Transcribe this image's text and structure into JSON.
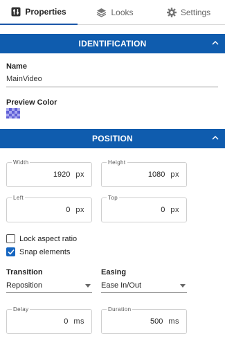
{
  "tabs": [
    {
      "label": "Properties",
      "icon": "properties-icon",
      "active": true
    },
    {
      "label": "Looks",
      "icon": "layers-icon"
    },
    {
      "label": "Settings",
      "icon": "gear-icon"
    }
  ],
  "sections": {
    "identification": "IDENTIFICATION",
    "position": "POSITION"
  },
  "identification": {
    "name_label": "Name",
    "name_value": "MainVideo",
    "preview_color_label": "Preview Color"
  },
  "position": {
    "width": {
      "label": "Width",
      "value": "1920",
      "unit": "px"
    },
    "height": {
      "label": "Height",
      "value": "1080",
      "unit": "px"
    },
    "left": {
      "label": "Left",
      "value": "0",
      "unit": "px"
    },
    "top": {
      "label": "Top",
      "value": "0",
      "unit": "px"
    },
    "lock_aspect_ratio": {
      "label": "Lock aspect ratio",
      "checked": false
    },
    "snap_elements": {
      "label": "Snap elements",
      "checked": true
    },
    "transition": {
      "label": "Transition",
      "value": "Reposition"
    },
    "easing": {
      "label": "Easing",
      "value": "Ease In/Out"
    },
    "delay": {
      "label": "Delay",
      "value": "0",
      "unit": "ms"
    },
    "duration": {
      "label": "Duration",
      "value": "500",
      "unit": "ms"
    }
  },
  "colors": {
    "accent": "#0f5cae",
    "checkbox": "#1565c0"
  }
}
